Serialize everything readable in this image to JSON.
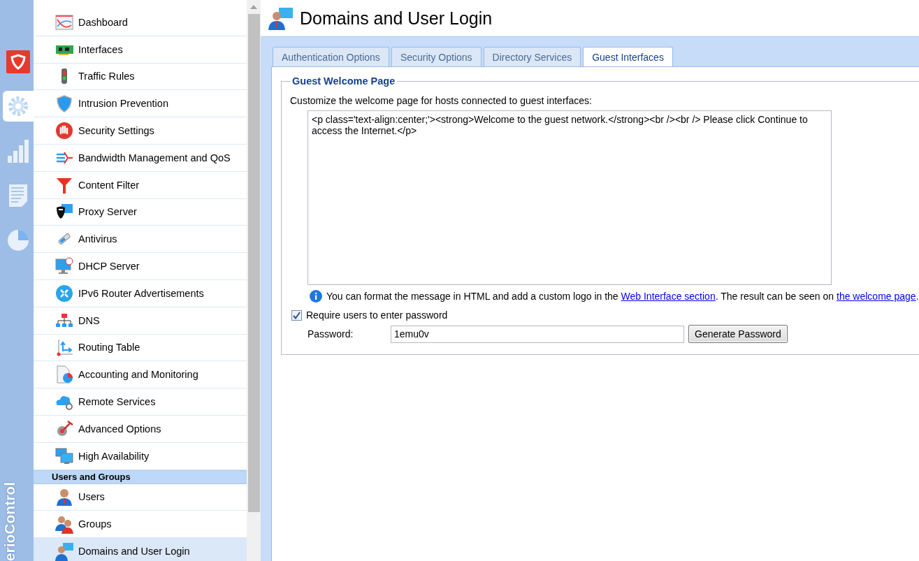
{
  "rail": {
    "items": [
      {
        "selected": false
      },
      {
        "selected": true
      },
      {
        "selected": false
      },
      {
        "selected": false
      },
      {
        "selected": false
      }
    ],
    "brand": "erioControl"
  },
  "sidebar": {
    "items": [
      {
        "label": "Dashboard",
        "selected": false
      },
      {
        "label": "Interfaces",
        "selected": false
      },
      {
        "label": "Traffic Rules",
        "selected": false
      },
      {
        "label": "Intrusion Prevention",
        "selected": false
      },
      {
        "label": "Security Settings",
        "selected": false
      },
      {
        "label": "Bandwidth Management and QoS",
        "selected": false
      },
      {
        "label": "Content Filter",
        "selected": false
      },
      {
        "label": "Proxy Server",
        "selected": false
      },
      {
        "label": "Antivirus",
        "selected": false
      },
      {
        "label": "DHCP Server",
        "selected": false
      },
      {
        "label": "IPv6 Router Advertisements",
        "selected": false
      },
      {
        "label": "DNS",
        "selected": false
      },
      {
        "label": "Routing Table",
        "selected": false
      },
      {
        "label": "Accounting and Monitoring",
        "selected": false
      },
      {
        "label": "Remote Services",
        "selected": false
      },
      {
        "label": "Advanced Options",
        "selected": false
      },
      {
        "label": "High Availability",
        "selected": false
      }
    ],
    "section": {
      "title": "Users and Groups",
      "items": [
        {
          "label": "Users",
          "selected": false
        },
        {
          "label": "Groups",
          "selected": false
        },
        {
          "label": "Domains and User Login",
          "selected": true
        }
      ]
    }
  },
  "header": {
    "title": "Domains and User Login"
  },
  "tabs": [
    {
      "label": "Authentication Options",
      "selected": false
    },
    {
      "label": "Security Options",
      "selected": false
    },
    {
      "label": "Directory Services",
      "selected": false
    },
    {
      "label": "Guest Interfaces",
      "selected": true
    }
  ],
  "fieldset": {
    "legend": "Guest Welcome Page",
    "description": "Customize the welcome page for hosts connected to guest interfaces:",
    "message": "<p class='text-align:center;'><strong>Welcome to the guest network.</strong><br /><br /> Please click Continue to access the Internet.</p>",
    "note": [
      {
        "kind": "text",
        "text": "You can format the message in HTML and add a custom logo in the "
      },
      {
        "kind": "link",
        "text": "Web Interface section"
      },
      {
        "kind": "text",
        "text": ". The result can be seen on "
      },
      {
        "kind": "link",
        "text": "the welcome page"
      },
      {
        "kind": "text",
        "text": "."
      }
    ],
    "require_password": {
      "label": "Require users to enter password",
      "checked": true
    },
    "password": {
      "label": "Password:",
      "value": "1emu0v"
    },
    "generate_button": "Generate Password"
  }
}
